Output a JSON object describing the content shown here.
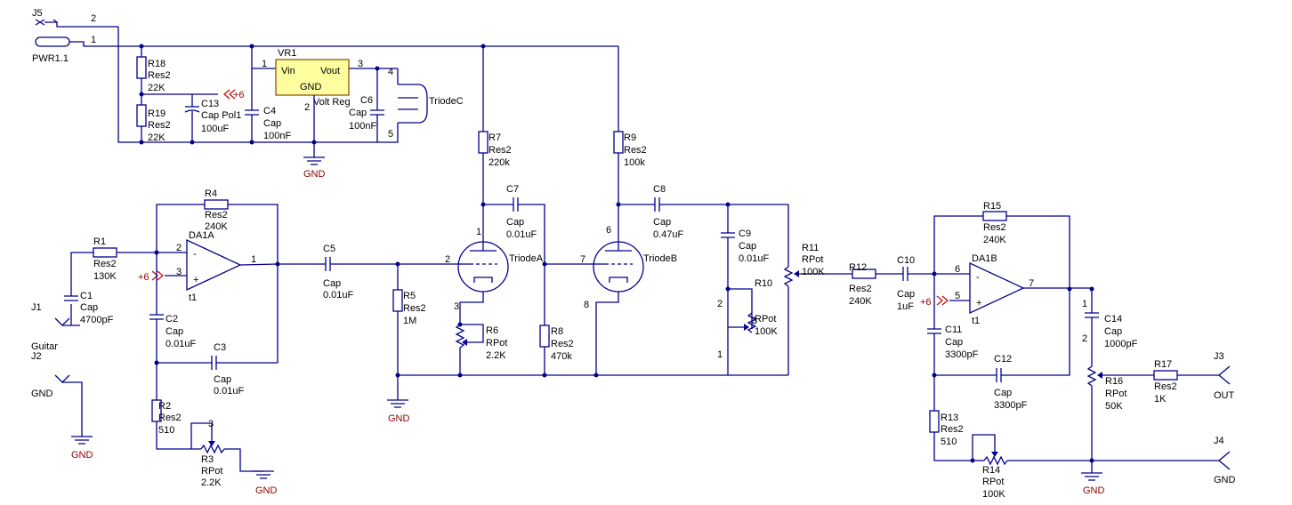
{
  "labels": {
    "J5": "J5",
    "PWR": "PWR1.1",
    "J1": "J1",
    "J1_desc": "Guitar",
    "J2": "J2",
    "J2_gnd": "GND",
    "J3": "J3",
    "J3_out": "OUT",
    "J4": "J4",
    "J4_gnd": "GND",
    "R18": "R18",
    "R18_t": "Res2",
    "R18_v": "22K",
    "R19": "R19",
    "R19_t": "Res2",
    "R19_v": "22K",
    "C13": "C13",
    "C13_t": "Cap Pol1",
    "C13_v": "100uF",
    "plus6_a": "+6",
    "C4": "C4",
    "C4_t": "Cap",
    "C4_v": "100nF",
    "VR1": "VR1",
    "Vin": "Vin",
    "Vout": "Vout",
    "GNDvr": "GND",
    "VoltReg": "Volt Reg",
    "C6": "C6",
    "C6_t": "Cap",
    "C6_v": "100nF",
    "TriodeC": "TriodeC",
    "gnd_top": "GND",
    "R7": "R7",
    "R7_t": "Res2",
    "R7_v": "220k",
    "R9": "R9",
    "R9_t": "Res2",
    "R9_v": "100k",
    "R4": "R4",
    "R4_t": "Res2",
    "R4_v": "240K",
    "DA1A": "DA1A",
    "DA1A_u": "t1",
    "R1": "R1",
    "R1_t": "Res2",
    "R1_v": "130K",
    "plus6_b": "+6",
    "C1": "C1",
    "C1_t": "Cap",
    "C1_v": "4700pF",
    "C2": "C2",
    "C2_t": "Cap",
    "C2_v": "0.01uF",
    "C3": "C3",
    "C3_t": "Cap",
    "C3_v": "0.01uF",
    "R2": "R2",
    "R2_t": "Res2",
    "R2_v": "510",
    "R3": "R3",
    "R3_t": "RPot",
    "R3_v": "2.2K",
    "gnd_j2": "GND",
    "gnd_r3": "GND",
    "C5": "C5",
    "C5_t": "Cap",
    "C5_v": "0.01uF",
    "R5": "R5",
    "R5_t": "Res2",
    "R5_v": "1M",
    "gnd_mid": "GND",
    "C7": "C7",
    "C7_t": "Cap",
    "C7_v": "0.01uF",
    "TriodeA": "TriodeA",
    "R6": "R6",
    "R6_t": "RPot",
    "R6_v": "2.2K",
    "R8": "R8",
    "R8_t": "Res2",
    "R8_v": "470k",
    "C8": "C8",
    "C8_t": "Cap",
    "C8_v": "0.47uF",
    "TriodeB": "TriodeB",
    "C9": "C9",
    "C9_t": "Cap",
    "C9_v": "0.01uF",
    "R10": "R10",
    "R10_t": "RPot",
    "R10_v": "100K",
    "R11": "R11",
    "R11_t": "RPot",
    "R11_v": "100K",
    "R12": "R12",
    "R12_t": "Res2",
    "R12_v": "240K",
    "C10": "C10",
    "C10_t": "Cap",
    "C10_v": "1uF",
    "R15": "R15",
    "R15_t": "Res2",
    "R15_v": "240K",
    "DA1B": "DA1B",
    "DA1B_u": "t1",
    "plus6_c": "+6",
    "C11": "C11",
    "C11_t": "Cap",
    "C11_v": "3300pF",
    "C12": "C12",
    "C12_t": "Cap",
    "C12_v": "3300pF",
    "R13": "R13",
    "R13_t": "Res2",
    "R13_v": "510",
    "R14": "R14",
    "R14_t": "RPot",
    "R14_v": "100K",
    "C14": "C14",
    "C14_t": "Cap",
    "C14_v": "1000pF",
    "R16": "R16",
    "R16_t": "RPot",
    "R16_v": "50K",
    "R17": "R17",
    "R17_t": "Res2",
    "R17_v": "1K",
    "gnd_right": "GND"
  },
  "pins": {
    "p1": "1",
    "p2": "2",
    "p3": "3",
    "p4": "4",
    "p5": "5",
    "p6": "6",
    "p7": "7",
    "p8": "8"
  },
  "colors": {
    "wire": "#00008b",
    "power": "#cc0000",
    "text": "#000000",
    "gnd_text": "#8b0000",
    "vr_fill": "#ffffa0"
  }
}
